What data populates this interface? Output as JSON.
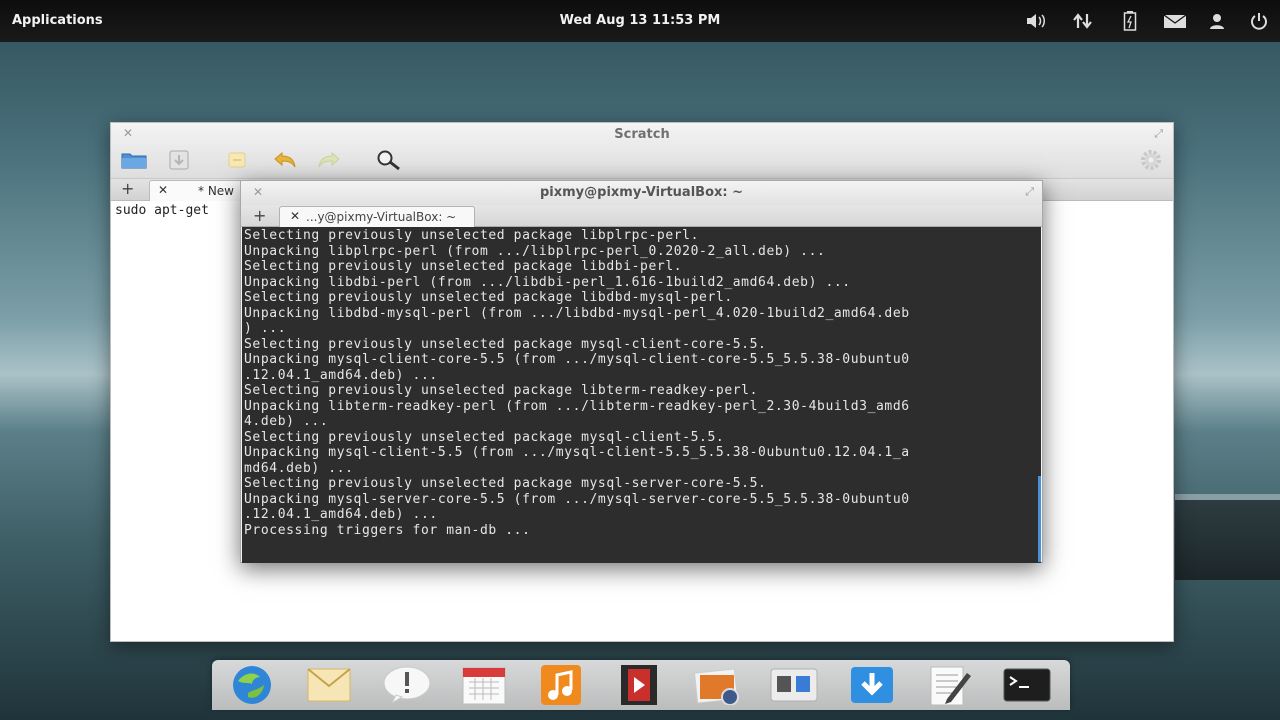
{
  "top_panel": {
    "applications_label": "Applications",
    "clock": "Wed Aug 13 11:53 PM",
    "tray_icons": [
      "volume-icon",
      "network-icon",
      "battery-icon",
      "mail-icon",
      "user-icon",
      "power-icon"
    ]
  },
  "scratch": {
    "title": "Scratch",
    "tab_label": "* New",
    "editor_text": "sudo apt-get",
    "toolbar_icons": [
      "open-folder-icon",
      "save-icon",
      "revert-icon",
      "undo-icon",
      "redo-icon",
      "search-icon"
    ]
  },
  "terminal": {
    "title": "pixmy@pixmy-VirtualBox: ~",
    "tab_label": "...y@pixmy-VirtualBox: ~",
    "lines": [
      "Selecting previously unselected package libplrpc-perl.",
      "Unpacking libplrpc-perl (from .../libplrpc-perl_0.2020-2_all.deb) ...",
      "Selecting previously unselected package libdbi-perl.",
      "Unpacking libdbi-perl (from .../libdbi-perl_1.616-1build2_amd64.deb) ...",
      "Selecting previously unselected package libdbd-mysql-perl.",
      "Unpacking libdbd-mysql-perl (from .../libdbd-mysql-perl_4.020-1build2_amd64.deb",
      ") ...",
      "Selecting previously unselected package mysql-client-core-5.5.",
      "Unpacking mysql-client-core-5.5 (from .../mysql-client-core-5.5_5.5.38-0ubuntu0",
      ".12.04.1_amd64.deb) ...",
      "Selecting previously unselected package libterm-readkey-perl.",
      "Unpacking libterm-readkey-perl (from .../libterm-readkey-perl_2.30-4build3_amd6",
      "4.deb) ...",
      "Selecting previously unselected package mysql-client-5.5.",
      "Unpacking mysql-client-5.5 (from .../mysql-client-5.5_5.5.38-0ubuntu0.12.04.1_a",
      "md64.deb) ...",
      "Selecting previously unselected package mysql-server-core-5.5.",
      "Unpacking mysql-server-core-5.5 (from .../mysql-server-core-5.5_5.5.38-0ubuntu0",
      ".12.04.1_amd64.deb) ...",
      "Processing triggers for man-db ..."
    ]
  },
  "dock": {
    "items": [
      "browser-icon",
      "mail-icon",
      "notification-icon",
      "calendar-icon",
      "music-icon",
      "video-icon",
      "photos-icon",
      "switchboard-icon",
      "software-center-icon",
      "text-editor-icon",
      "terminal-icon"
    ]
  },
  "colors": {
    "terminal_bg": "#2d2d2d",
    "terminal_fg": "#e6e6e6",
    "panel_bg": "#111111",
    "scrollbar": "#4a90d9"
  }
}
